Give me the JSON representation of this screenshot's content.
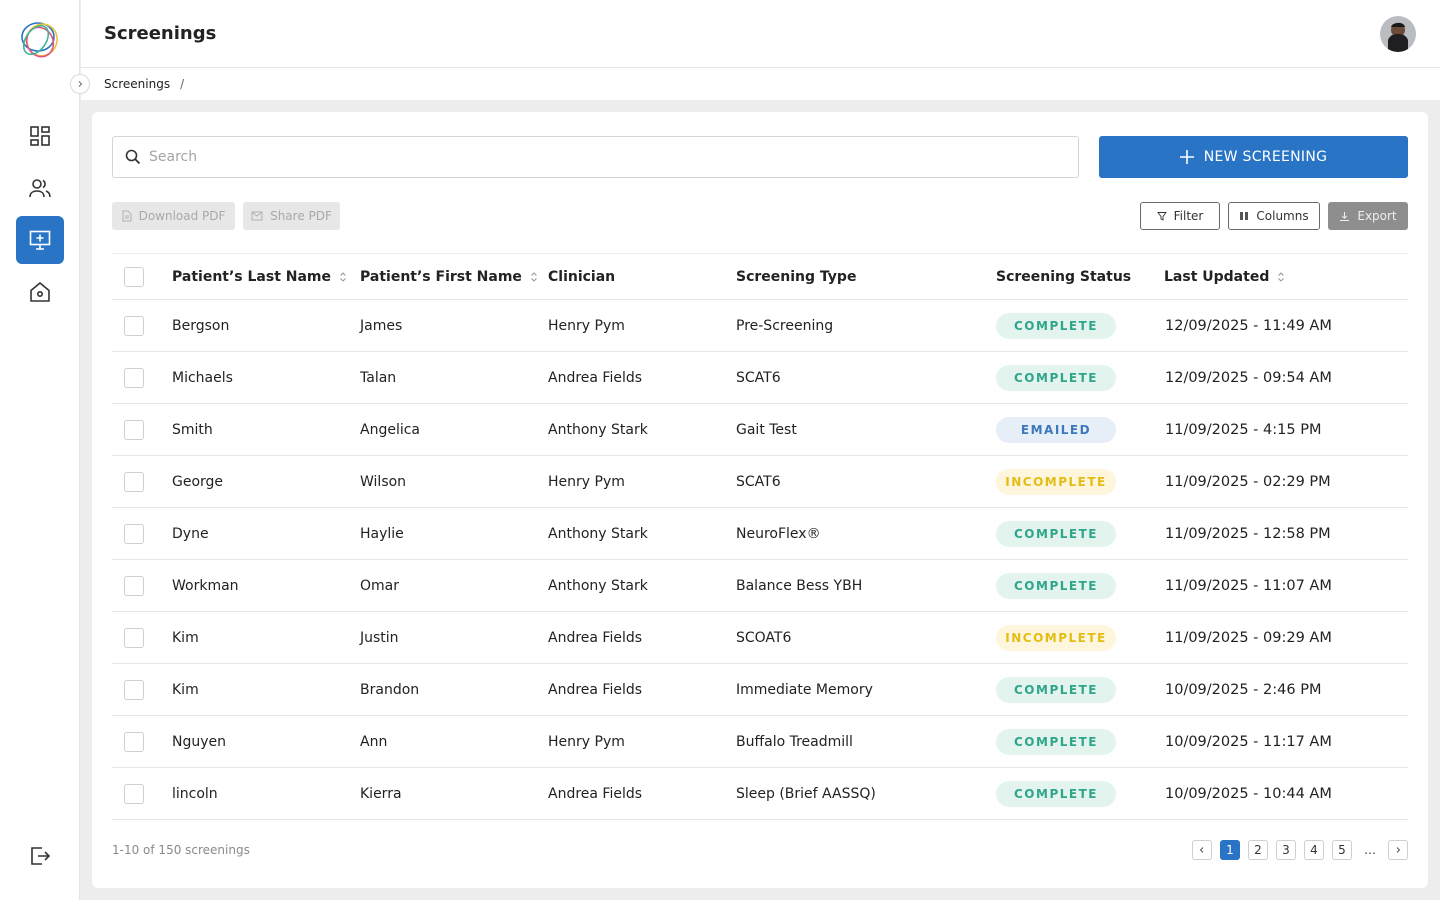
{
  "header": {
    "title": "Screenings"
  },
  "breadcrumb": {
    "items": [
      "Screenings"
    ],
    "separator": "/"
  },
  "search": {
    "placeholder": "Search",
    "value": ""
  },
  "actions": {
    "new_screening": "NEW SCREENING",
    "download_pdf": "Download PDF",
    "share_pdf": "Share PDF",
    "filter": "Filter",
    "columns": "Columns",
    "export": "Export"
  },
  "table": {
    "columns": [
      "Patient’s Last Name",
      "Patient’s First Name",
      "Clinician",
      "Screening Type",
      "Screening Status",
      "Last Updated"
    ],
    "rows": [
      {
        "last": "Bergson",
        "first": "James",
        "clinician": "Henry Pym",
        "type": "Pre-Screening",
        "status": "COMPLETE",
        "updated": "12/09/2025 -  11:49 AM"
      },
      {
        "last": "Michaels",
        "first": "Talan",
        "clinician": "Andrea Fields",
        "type": "SCAT6",
        "status": "COMPLETE",
        "updated": "12/09/2025 -  09:54 AM"
      },
      {
        "last": "Smith",
        "first": "Angelica",
        "clinician": "Anthony Stark",
        "type": "Gait Test",
        "status": "EMAILED",
        "updated": "11/09/2025 -  4:15 PM"
      },
      {
        "last": "George",
        "first": "Wilson",
        "clinician": "Henry Pym",
        "type": "SCAT6",
        "status": "INCOMPLETE",
        "updated": "11/09/2025 -  02:29 PM"
      },
      {
        "last": "Dyne",
        "first": "Haylie",
        "clinician": "Anthony Stark",
        "type": "NeuroFlex®",
        "status": "COMPLETE",
        "updated": "11/09/2025 -  12:58 PM"
      },
      {
        "last": "Workman",
        "first": "Omar",
        "clinician": "Anthony Stark",
        "type": "Balance Bess YBH",
        "status": "COMPLETE",
        "updated": "11/09/2025 - 11:07 AM"
      },
      {
        "last": "Kim",
        "first": "Justin",
        "clinician": "Andrea Fields",
        "type": "SCOAT6",
        "status": "INCOMPLETE",
        "updated": "11/09/2025 -  09:29 AM"
      },
      {
        "last": "Kim",
        "first": "Brandon",
        "clinician": "Andrea Fields",
        "type": "Immediate Memory",
        "status": "COMPLETE",
        "updated": "10/09/2025 - 2:46 PM"
      },
      {
        "last": "Nguyen",
        "first": "Ann",
        "clinician": "Henry Pym",
        "type": "Buffalo Treadmill",
        "status": "COMPLETE",
        "updated": "10/09/2025 - 11:17 AM"
      },
      {
        "last": "lincoln",
        "first": "Kierra",
        "clinician": "Andrea Fields",
        "type": "Sleep (Brief AASSQ)",
        "status": "COMPLETE",
        "updated": "10/09/2025 - 10:44 AM"
      }
    ]
  },
  "footer": {
    "count_text": "1-10 of 150 screenings"
  },
  "pagination": {
    "pages": [
      "1",
      "2",
      "3",
      "4",
      "5"
    ],
    "ellipsis": "…",
    "current": "1"
  },
  "colors": {
    "primary": "#2a74c5",
    "complete": "#2fa58b",
    "emailed": "#3b78bd",
    "incomplete": "#e3bd14"
  },
  "icons": {
    "sidebar": [
      "dashboard-icon",
      "users-icon",
      "screening-monitor-icon",
      "home-icon",
      "logout-icon"
    ],
    "search": "search-icon",
    "sort": "sort-icon"
  }
}
